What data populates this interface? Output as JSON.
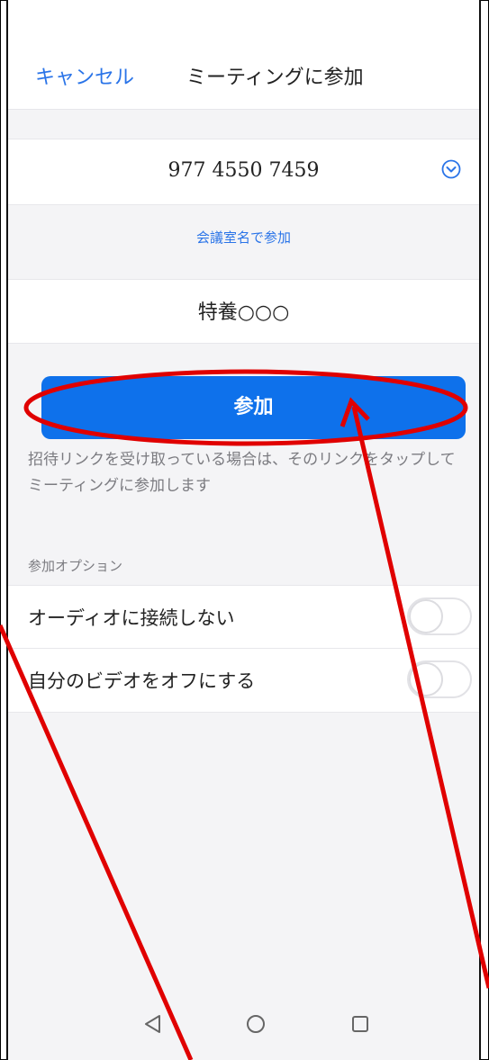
{
  "header": {
    "cancel_label": "キャンセル",
    "title": "ミーティングに参加"
  },
  "meeting": {
    "id_value": "977 4550 7459",
    "join_by_room_label": "会議室名で参加",
    "name_value": "特養○○○"
  },
  "join_button_label": "参加",
  "hint_text": "招待リンクを受け取っている場合は、そのリンクをタップしてミーティングに参加します",
  "options": {
    "section_label": "参加オプション",
    "items": [
      {
        "label": "オーディオに接続しない",
        "enabled": false
      },
      {
        "label": "自分のビデオをオフにする",
        "enabled": false
      }
    ]
  },
  "navbar": {
    "buttons": [
      "back-icon",
      "home-icon",
      "recents-icon"
    ]
  },
  "colors": {
    "accent": "#0e71eb",
    "link": "#2a74e8",
    "annotation": "#e00000"
  }
}
